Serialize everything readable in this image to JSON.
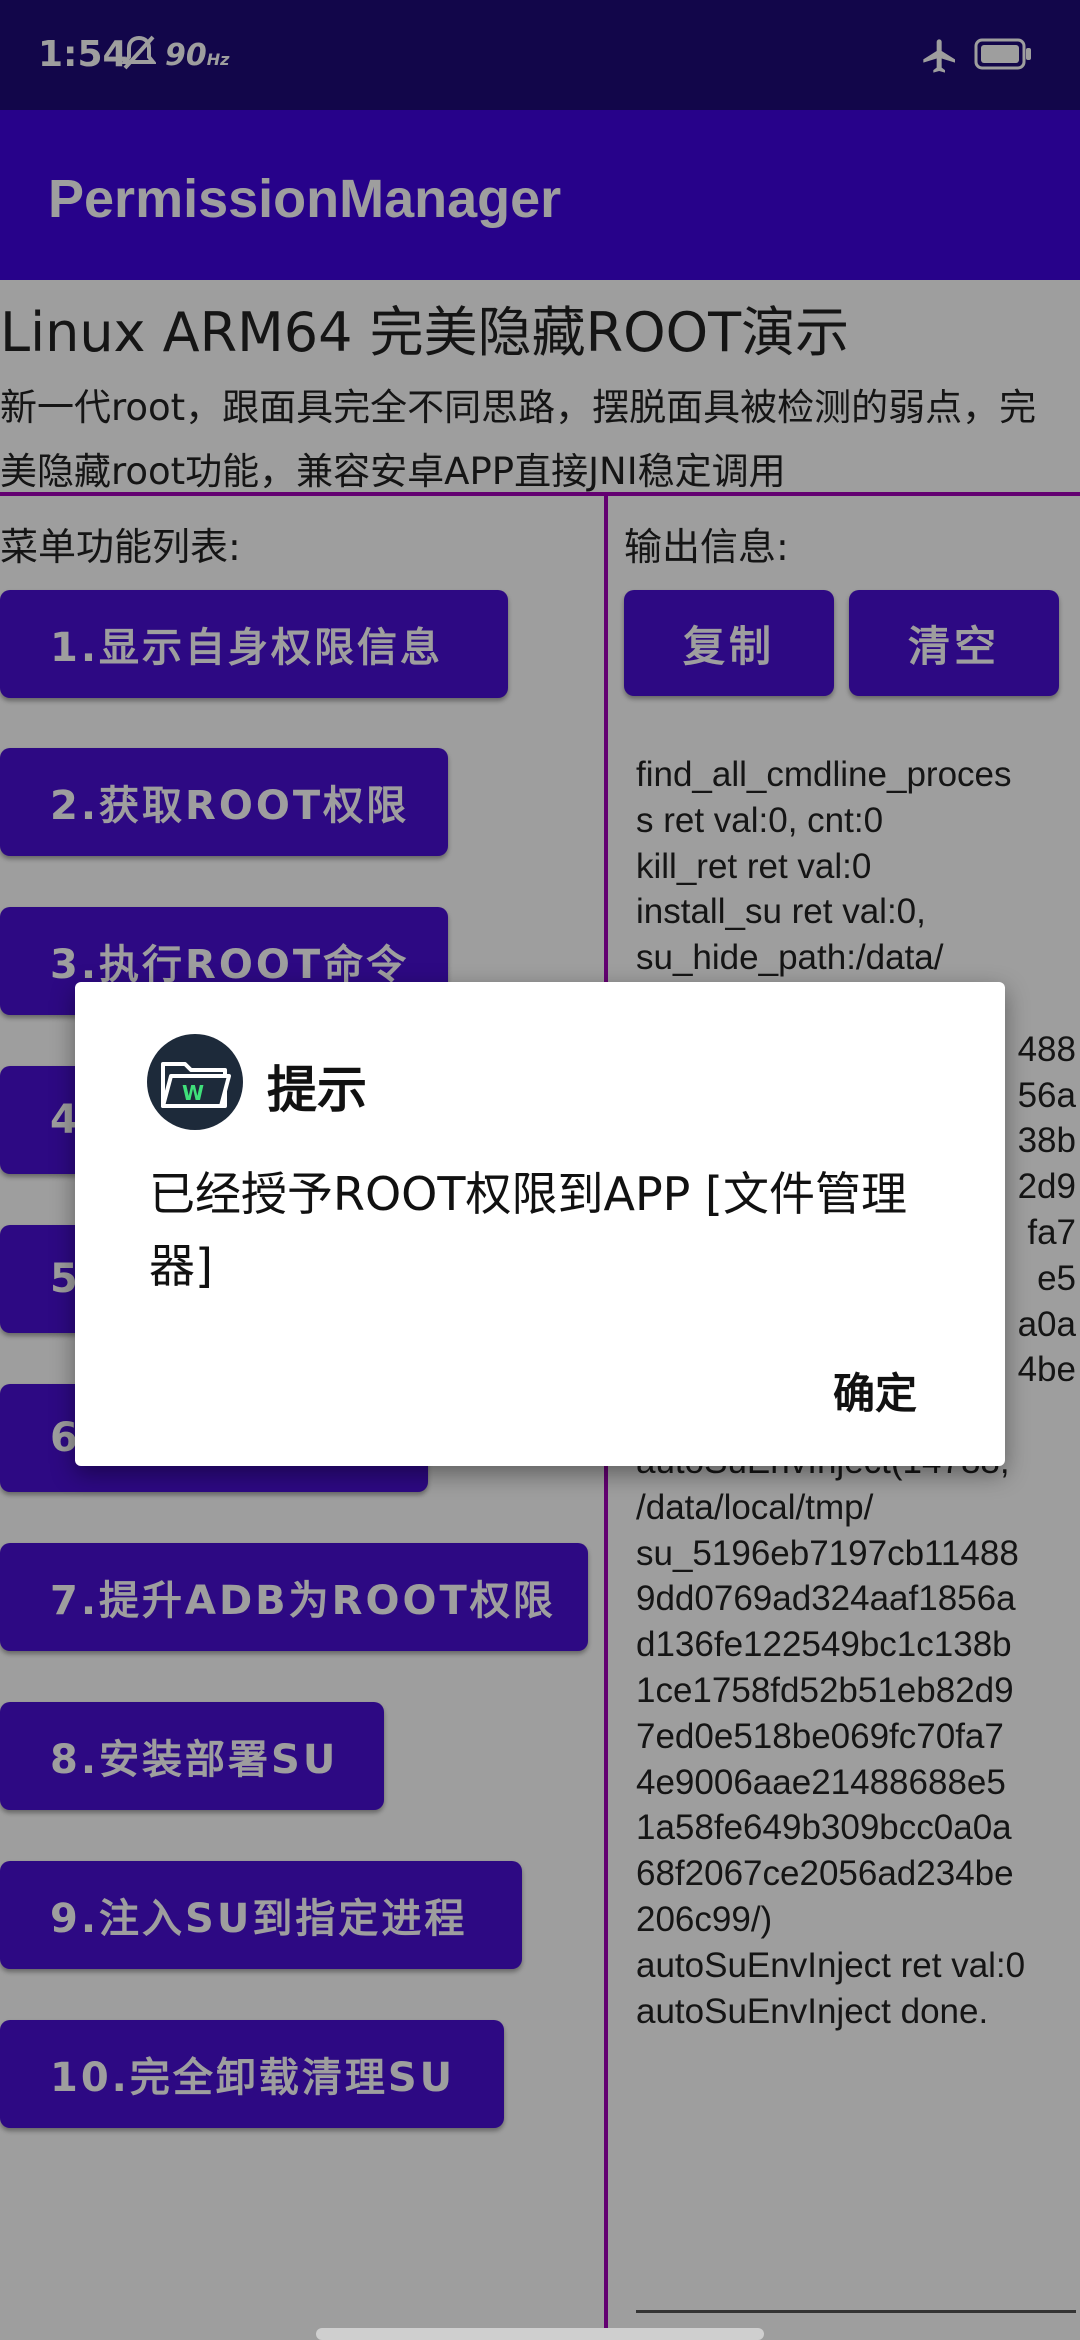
{
  "status_bar": {
    "time": "1:54",
    "refresh_rate": "90",
    "refresh_unit": "Hz"
  },
  "app_bar": {
    "title": "PermissionManager"
  },
  "heading": "Linux ARM64 完美隐藏ROOT演示",
  "description": "新一代root，跟面具完全不同思路，摆脱面具被检测的弱点，完美隐藏root功能，兼容安卓APP直接JNI稳定调用",
  "menu_label": "菜单功能列表:",
  "output_label": "输出信息:",
  "menu_items": [
    {
      "label": "1.显示自身权限信息"
    },
    {
      "label": "2.获取ROOT权限"
    },
    {
      "label": "3.执行ROOT命令"
    },
    {
      "label": "4"
    },
    {
      "label": "5"
    },
    {
      "label": "6"
    },
    {
      "label": "7.提升ADB为ROOT权限"
    },
    {
      "label": "8.安装部署SU"
    },
    {
      "label": "9.注入SU到指定进程"
    },
    {
      "label": "10.完全卸载清理SU"
    }
  ],
  "output_buttons": {
    "copy": "复制",
    "clear": "清空"
  },
  "output_lines": [
    "find_all_cmdline_proces",
    "s ret val:0, cnt:0",
    "kill_ret ret val:0",
    "install_su ret val:0,",
    "su_hide_path:/data/",
    "",
    "488",
    "56a",
    "38b",
    "2d9",
    "fa7",
    "e5",
    "a0a",
    "4be",
    "",
    "autoSuEnvInject(14788,",
    "/data/local/tmp/",
    "su_5196eb7197cb11488",
    "9dd0769ad324aaf1856a",
    "d136fe122549bc1c138b",
    "1ce1758fd52b51eb82d9",
    "7ed0e518be069fc70fa7",
    "4e9006aae21488688e5",
    "1a58fe649b309bcc0a0a",
    "68f2067ce2056ad234be",
    "206c99/)",
    "autoSuEnvInject ret val:0",
    "autoSuEnvInject done."
  ],
  "dialog": {
    "title": "提示",
    "message": "已经授予ROOT权限到APP [文件管理器]",
    "ok": "确定"
  }
}
